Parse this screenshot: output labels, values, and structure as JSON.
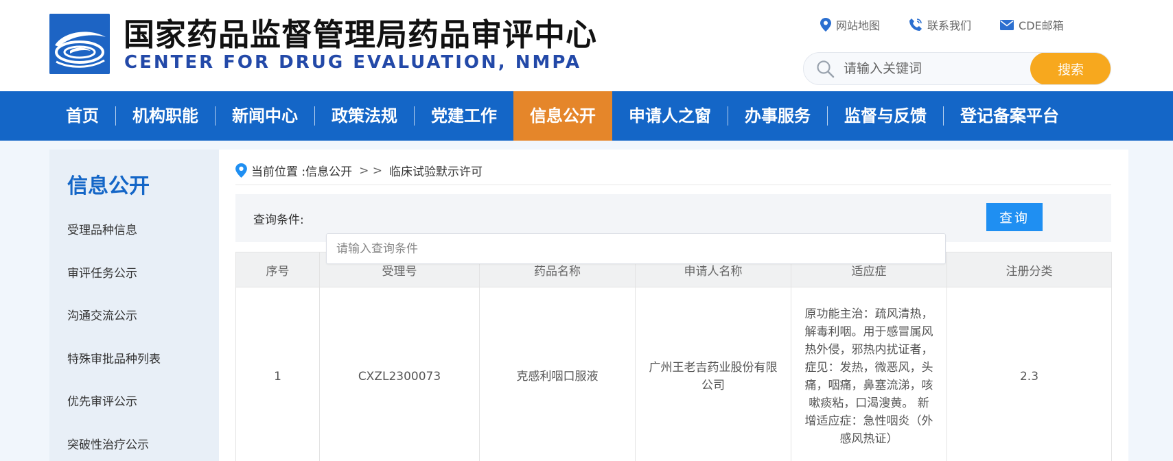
{
  "header": {
    "title": "国家药品监督管理局药品审评中心",
    "subtitle": "CENTER FOR DRUG EVALUATION, NMPA",
    "logo_icon": "bird-over-waves-logo",
    "links": [
      {
        "label": "网站地图",
        "icon": "map-pin-icon"
      },
      {
        "label": "联系我们",
        "icon": "phone-icon"
      },
      {
        "label": "CDE邮箱",
        "icon": "mail-icon"
      }
    ],
    "search": {
      "placeholder": "请输入关键词",
      "button": "搜索"
    }
  },
  "nav": {
    "items": [
      "首页",
      "机构职能",
      "新闻中心",
      "政策法规",
      "党建工作",
      "信息公开",
      "申请人之窗",
      "办事服务",
      "监督与反馈",
      "登记备案平台"
    ],
    "active": "信息公开"
  },
  "sidebar": {
    "title": "信息公开",
    "items": [
      "受理品种信息",
      "审评任务公示",
      "沟通交流公示",
      "特殊审批品种列表",
      "优先审评公示",
      "突破性治疗公示"
    ]
  },
  "breadcrumb": {
    "prefix": "当前位置 : ",
    "section": "信息公开",
    "separator": "> >",
    "current": "临床试验默示许可"
  },
  "query": {
    "label": "查询条件:",
    "placeholder": "请输入查询条件",
    "button": "查询"
  },
  "table": {
    "columns": [
      "序号",
      "受理号",
      "药品名称",
      "申请人名称",
      "适应症",
      "注册分类"
    ],
    "rows": [
      {
        "index": "1",
        "acceptance_no": "CXZL2300073",
        "drug_name": "克感利咽口服液",
        "applicant": "广州王老吉药业股份有限公司",
        "indication": "原功能主治：疏风清热，解毒利咽。用于感冒属风热外侵，邪热内扰证者，症见：发热，微恶风，头痛，咽痛，鼻塞流涕，咳嗽痰粘，口渴溲黄。 新增适应症：急性咽炎（外感风热证）",
        "category": "2.3"
      }
    ]
  },
  "colors": {
    "brand_blue": "#1466c7",
    "nav_active": "#e5862a",
    "search_button": "#f7a81e",
    "query_button": "#1f8ff2"
  }
}
